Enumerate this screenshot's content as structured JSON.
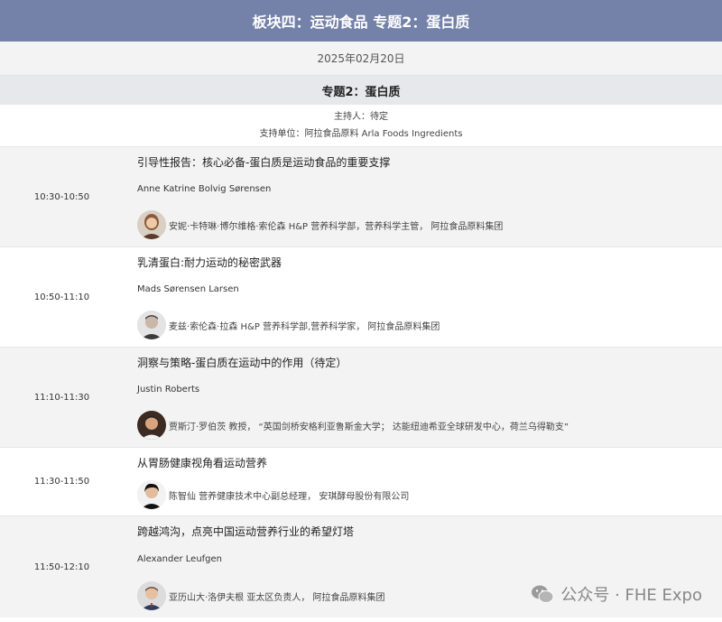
{
  "banner": {
    "title": "板块四：运动食品 专题2：蛋白质"
  },
  "date": "2025年02月20日",
  "topic": "专题2：蛋白质",
  "host": "主持人：待定",
  "sponsor": "支持单位：阿拉食品原料 Arla Foods Ingredients",
  "sessions": [
    {
      "time": "10:30-10:50",
      "title": "引导性报告：核心必备-蛋白质是运动食品的重要支撑",
      "speaker_en": "Anne Katrine Bolvig Sørensen",
      "speaker_desc": "安妮·卡特琳·博尔维格·索伦森 H&P 营养科学部，营养科学主管， 阿拉食品原料集团"
    },
    {
      "time": "10:50-11:10",
      "title": "乳清蛋白:耐力运动的秘密武器",
      "speaker_en": "Mads Sørensen Larsen",
      "speaker_desc": "麦兹·索伦森·拉森 H&P 营养科学部,营养科学家， 阿拉食品原料集团"
    },
    {
      "time": "11:10-11:30",
      "title": "洞察与策略-蛋白质在运动中的作用（待定）",
      "speaker_en": "Justin Roberts",
      "speaker_desc": "贾斯汀·罗伯茨 教授， “英国剑桥安格利亚鲁斯金大学； 达能纽迪希亚全球研发中心，荷兰乌得勒支”"
    },
    {
      "time": "11:30-11:50",
      "title": "从胃肠健康视角看运动营养",
      "speaker_en": "",
      "speaker_desc": "陈智仙 营养健康技术中心副总经理， 安琪酵母股份有限公司"
    },
    {
      "time": "11:50-12:10",
      "title": "跨越鸿沟，点亮中国运动营养行业的希望灯塔",
      "speaker_en": "Alexander Leufgen",
      "speaker_desc": "亚历山大·洛伊夫根 亚太区负责人， 阿拉食品原料集团"
    }
  ],
  "watermark": "公众号 · FHE Expo"
}
